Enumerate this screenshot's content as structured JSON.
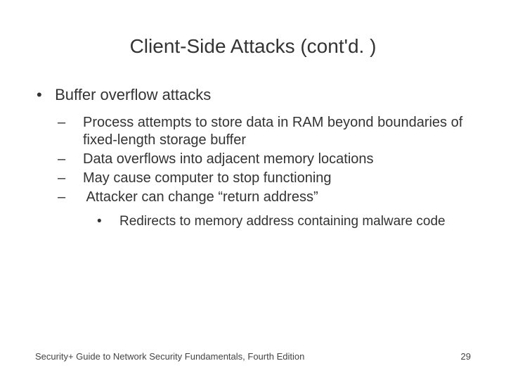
{
  "title": "Client-Side Attacks (cont'd. )",
  "bullets": {
    "l1": "Buffer overflow attacks",
    "l2a": "Process attempts to store data in RAM beyond boundaries of fixed-length storage buffer",
    "l2b": "Data overflows into adjacent memory locations",
    "l2c": "May cause computer to stop functioning",
    "l2d": "Attacker can change “return address”",
    "l3a": "Redirects to memory address containing malware code"
  },
  "footer": {
    "source": "Security+ Guide to Network Security Fundamentals, Fourth Edition",
    "page": "29"
  }
}
